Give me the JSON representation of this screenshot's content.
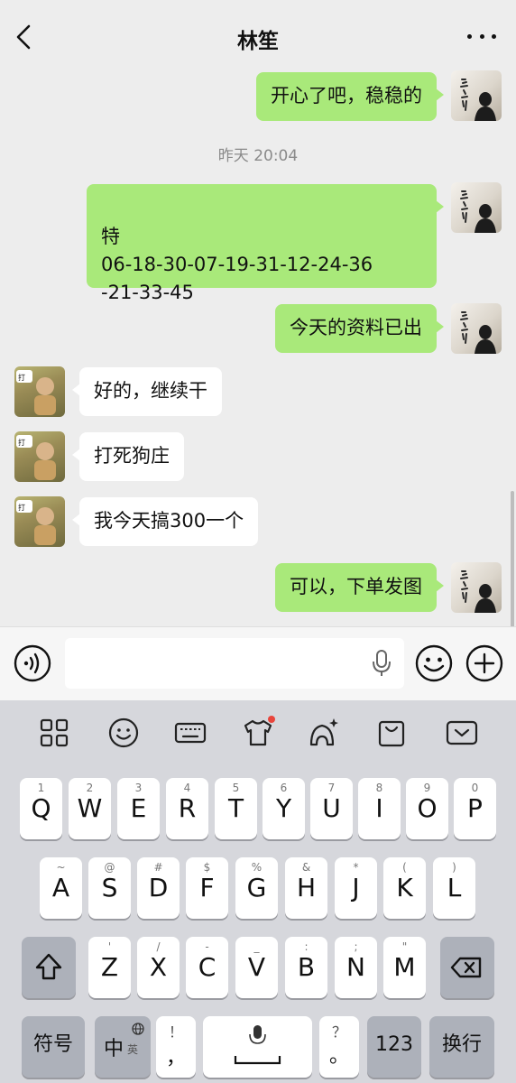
{
  "header": {
    "title": "林笙"
  },
  "chat": {
    "timestamp": "昨天 20:04",
    "messages": [
      {
        "sender": "self",
        "text": "开心了吧，稳稳的"
      },
      {
        "sender": "self",
        "text": "特\n06-18-30-07-19-31-12-24-36\n-21-33-45"
      },
      {
        "sender": "self",
        "text": "今天的资料已出"
      },
      {
        "sender": "other",
        "text": "好的，继续干"
      },
      {
        "sender": "other",
        "text": "打死狗庄"
      },
      {
        "sender": "other",
        "text": "我今天搞300一个"
      },
      {
        "sender": "self",
        "text": "可以，下单发图"
      }
    ]
  },
  "input": {
    "placeholder": ""
  },
  "keyboard": {
    "toolbar": [
      "grid-icon",
      "smiley-icon",
      "keyboard-icon",
      "tshirt-icon",
      "ai-assistant-icon",
      "clipboard-icon",
      "collapse-keyboard-icon"
    ],
    "row1": [
      {
        "main": "Q",
        "hint": "1"
      },
      {
        "main": "W",
        "hint": "2"
      },
      {
        "main": "E",
        "hint": "3"
      },
      {
        "main": "R",
        "hint": "4"
      },
      {
        "main": "T",
        "hint": "5"
      },
      {
        "main": "Y",
        "hint": "6"
      },
      {
        "main": "U",
        "hint": "7"
      },
      {
        "main": "I",
        "hint": "8"
      },
      {
        "main": "O",
        "hint": "9"
      },
      {
        "main": "P",
        "hint": "0"
      }
    ],
    "row2": [
      {
        "main": "A",
        "hint": "~"
      },
      {
        "main": "S",
        "hint": "@"
      },
      {
        "main": "D",
        "hint": "#"
      },
      {
        "main": "F",
        "hint": "$"
      },
      {
        "main": "G",
        "hint": "%"
      },
      {
        "main": "H",
        "hint": "&"
      },
      {
        "main": "J",
        "hint": "*"
      },
      {
        "main": "K",
        "hint": "("
      },
      {
        "main": "L",
        "hint": ")"
      }
    ],
    "row3": [
      {
        "main": "Z",
        "hint": "'"
      },
      {
        "main": "X",
        "hint": "/"
      },
      {
        "main": "C",
        "hint": "-"
      },
      {
        "main": "V",
        "hint": "_"
      },
      {
        "main": "B",
        "hint": ":"
      },
      {
        "main": "N",
        "hint": ";"
      },
      {
        "main": "M",
        "hint": "\""
      }
    ],
    "symbols_label": "符号",
    "zh_label": "中",
    "en_label": "英",
    "punct_main": "，",
    "punct_hint": "！",
    "period_main": "。",
    "period_hint": "？",
    "num_label": "123",
    "enter_label": "换行"
  }
}
